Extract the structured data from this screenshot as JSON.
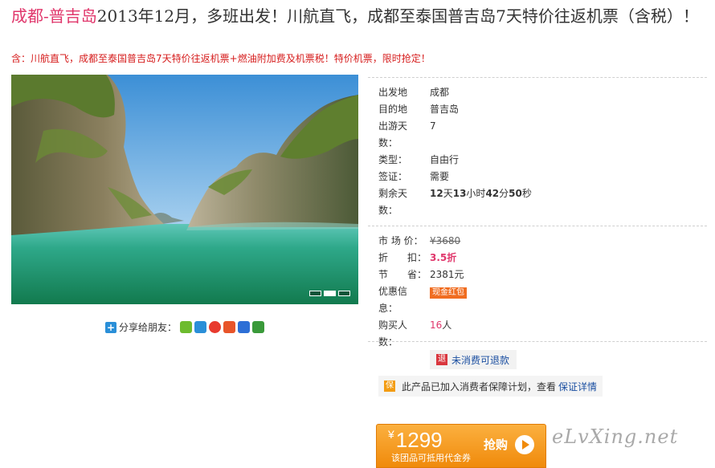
{
  "title": {
    "destination": "成都-普吉岛",
    "text": "2013年12月，多班出发！川航直飞，成都至泰国普吉岛7天特价往返机票（含税）！"
  },
  "subtitle": "含：川航直飞，成都至泰国普吉岛7天特价往返机票+燃油附加费及机票税！特价机票，限时抢定！",
  "share": {
    "label": "分享给朋友：",
    "icons": [
      "kaixin-icon",
      "qq-space-icon",
      "weibo-icon",
      "renren-icon",
      "baidu-icon",
      "douban-icon"
    ]
  },
  "trip": {
    "departure_label": "出发地",
    "departure": "成都",
    "destination_label": "目的地",
    "destination": "普吉岛",
    "days_label_1": "出游天",
    "days_label_2": "数：",
    "days": "7",
    "type_label": "类型：",
    "type": "自由行",
    "visa_label": "签证：",
    "visa": "需要",
    "remaining_label_1": "剩余天",
    "remaining_label_2": "数：",
    "remaining": {
      "d": "12",
      "d_unit": "天",
      "h": "13",
      "h_unit": "小时",
      "m": "42",
      "m_unit": "分",
      "s": "50",
      "s_unit": "秒"
    }
  },
  "pricing": {
    "market_label": "市 场 价：",
    "market_price": "¥3680",
    "discount_label": "折　　扣：",
    "discount": "3.5折",
    "save_label": "节　　省：",
    "save": "2381元",
    "promo_label_1": "优惠信",
    "promo_label_2": "息：",
    "promo_badge": "现金红包",
    "buyers_label_1": "购买人",
    "buyers_label_2": "数：",
    "buyers": "16",
    "buyers_unit": "人"
  },
  "refund": {
    "icon": "退",
    "label": "未消费可退款"
  },
  "guarantee": {
    "icon": "保",
    "text": "此产品已加入消费者保障计划，查看",
    "link": "保证详情"
  },
  "buy": {
    "currency": "¥",
    "price": "1299",
    "note": "该团品可抵用代金券",
    "label": "抢购"
  },
  "watermark": "eLvXing.net",
  "colors": {
    "accent_pink": "#e0366b",
    "subtitle_red": "#d61d1d",
    "buy_orange": "#f08a0b",
    "link_blue": "#1b4fa1"
  }
}
